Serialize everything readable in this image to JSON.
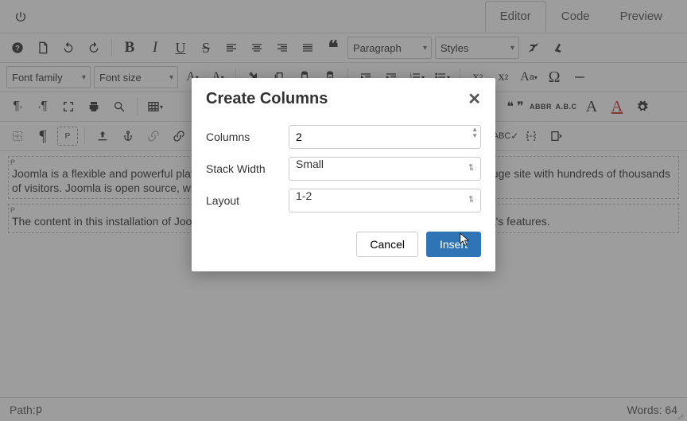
{
  "tabs": {
    "editor": "Editor",
    "code": "Code",
    "preview": "Preview"
  },
  "sel": {
    "paragraph": "Paragraph",
    "styles": "Styles",
    "font_family": "Font family",
    "font_size": "Font size"
  },
  "abbr": {
    "abbr": "ABBR",
    "abc": "A.B.C"
  },
  "content": {
    "p1": "Joomla is a flexible and powerful platform, whether you are building a small site for yourself or a huge site with hundreds of thousands of visitors. Joomla is open source, which means you can make it work just the way you want it to.",
    "p2": "The content in this installation of Joomla has been designed to give you an in depth tour of Joomla's features.",
    "tag": "P"
  },
  "status": {
    "path_label": "Path: ",
    "path_value": "p",
    "words_label": "Words: ",
    "words_value": "64"
  },
  "dialog": {
    "title": "Create Columns",
    "columns_label": "Columns",
    "columns_value": "2",
    "stack_label": "Stack Width",
    "stack_value": "Small",
    "layout_label": "Layout",
    "layout_value": "1-2",
    "cancel": "Cancel",
    "insert": "Insert"
  }
}
